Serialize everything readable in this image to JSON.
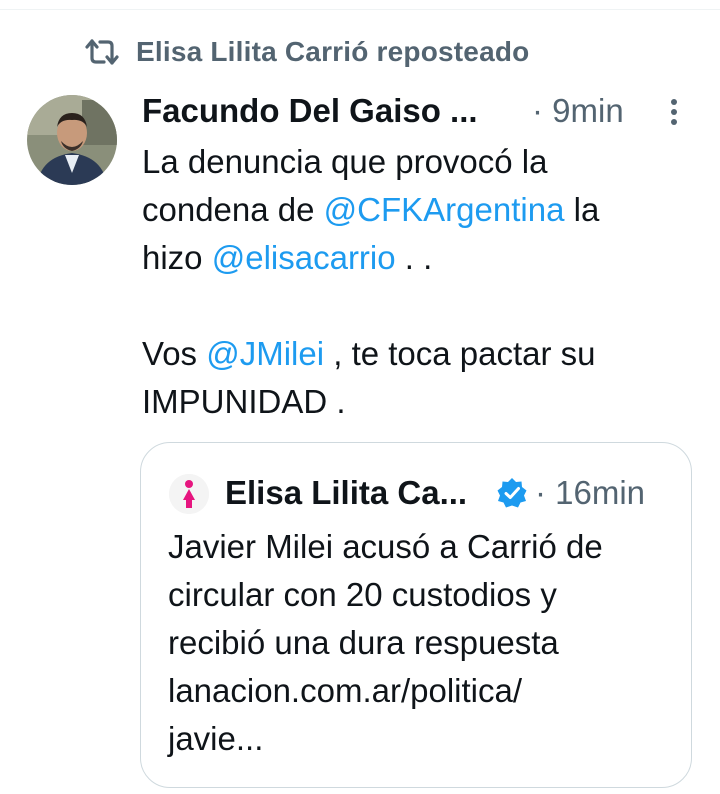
{
  "repost": {
    "icon": "repost-icon",
    "text": "Elisa Lilita Carrió reposteado"
  },
  "tweet": {
    "author_name": "Facundo Del Gaiso ...",
    "time": "· 9min",
    "more_icon": "vertical-dots-icon",
    "line1": "La denuncia que provocó la",
    "line2_pre": "condena de ",
    "line2_mention": "@CFKArgentina",
    "line2_post": " la",
    "line3_pre": "hizo ",
    "line3_mention": "@elisacarrio",
    "line3_post": " . .",
    "line5_pre": "Vos ",
    "line5_mention": "@JMilei",
    "line5_post": " , te toca pactar su",
    "line6": "IMPUNIDAD ."
  },
  "quote": {
    "author_name": "Elisa Lilita Ca...",
    "verified_icon": "verified-badge-icon",
    "time": "· 16min",
    "line1": "Javier Milei acusó a Carrió de",
    "line2": "circular con 20 custodios y",
    "line3": "recibió una dura respuesta",
    "line4": "lanacion.com.ar/politica/",
    "line5": "javie..."
  },
  "colors": {
    "text": "#0f1419",
    "secondary": "#536471",
    "mention": "#1d9bf0",
    "border": "#cfd9de",
    "verified": "#1d9bf0"
  }
}
